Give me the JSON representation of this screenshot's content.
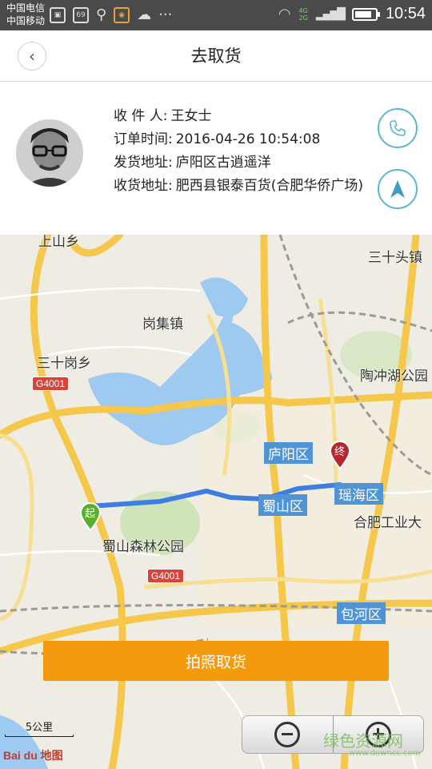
{
  "status_bar": {
    "carrier_1": "中国电信",
    "carrier_2": "中国移动",
    "notif_badge": "69",
    "net_1": "4G",
    "net_2": "2G",
    "time": "10:54"
  },
  "header": {
    "title": "去取货",
    "back_icon": "chevron-left-icon"
  },
  "order": {
    "recipient_label": "收 件 人:",
    "recipient_value": "王女士",
    "time_label": "订单时间:",
    "time_value": "2016-04-26 10:54:08",
    "ship_label": "发货地址:",
    "ship_value": "庐阳区古逍遥洋",
    "receive_label": "收货地址:",
    "receive_value": "肥西县银泰百货(合肥华侨广场)",
    "phone_icon": "phone-icon",
    "navigate_icon": "navigation-arrow-icon"
  },
  "map": {
    "places": {
      "p1": "上山乡",
      "p2": "三十头镇",
      "p3": "岗集镇",
      "p4": "三十岗乡",
      "p5": "陶冲湖公园",
      "p6": "蜀山森林公园",
      "p7": "合肥工业大"
    },
    "districts": {
      "d1": "庐阳区",
      "d2": "蜀山区",
      "d3": "瑶海区",
      "d4": "包河区"
    },
    "highways": {
      "h1": "G4001",
      "h2": "G4001"
    },
    "start_marker": "起",
    "end_marker": "终",
    "scale_label": "5公里",
    "logo_text": "Bai du 地图",
    "zoom_out_icon": "zoom-out-icon",
    "zoom_in_icon": "zoom-in-icon",
    "watermark": "绿色资源网",
    "watermark_url": "www.downcc.com"
  },
  "actions": {
    "pickup_label": "拍照取货"
  },
  "colors": {
    "accent_orange": "#f49a0d",
    "accent_blue": "#5ab7d0",
    "district_blue": "#4f95d6",
    "route_blue": "#3d7fe0"
  }
}
